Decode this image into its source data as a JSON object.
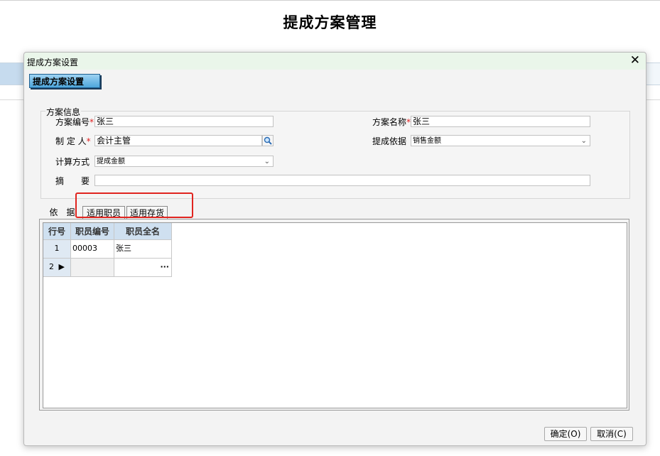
{
  "page": {
    "title": "提成方案管理"
  },
  "dialog": {
    "title": "提成方案设置",
    "close_glyph": "✕",
    "header_button": "提成方案设置",
    "group_legend": "方案信息",
    "fields": {
      "scheme_no": {
        "label": "方案编号",
        "required_mark": "*",
        "value": "张三"
      },
      "scheme_name": {
        "label": "方案名称",
        "required_mark": "*",
        "value": "张三"
      },
      "creator": {
        "label": "制 定 人",
        "required_mark": "*",
        "value": "会计主管"
      },
      "basis": {
        "label": "提成依据",
        "value": "销售金额"
      },
      "calc_method": {
        "label": "计算方式",
        "value": "提成金额"
      },
      "summary": {
        "label": "摘　　要",
        "value": ""
      }
    },
    "tabs": [
      "依　据",
      "适用职员",
      "适用存货"
    ],
    "grid": {
      "columns": [
        "行号",
        "职员编号",
        "职员全名"
      ],
      "rows": [
        {
          "no": "1",
          "emp_no": "00003",
          "emp_name": "张三"
        },
        {
          "no": "2",
          "row_marker": "▶",
          "emp_no": "",
          "emp_name": "",
          "ellipsis": "···"
        }
      ]
    },
    "buttons": {
      "ok": "确定(O)",
      "cancel": "取消(C)"
    }
  }
}
